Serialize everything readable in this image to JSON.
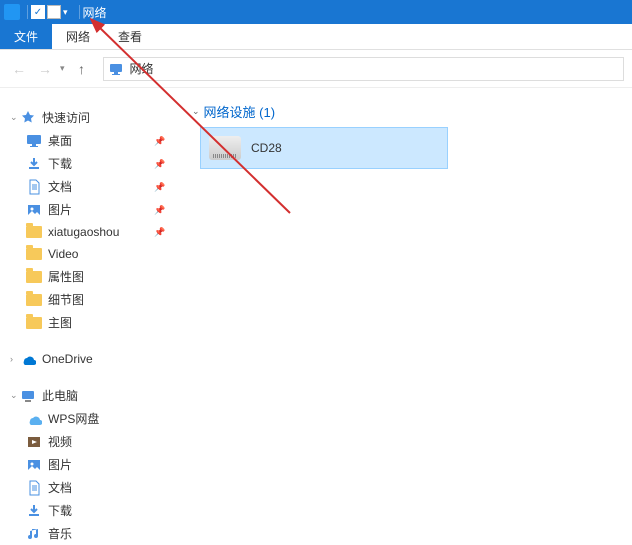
{
  "titlebar": {
    "title": "网络"
  },
  "ribbon": {
    "tabs": [
      {
        "label": "文件",
        "kind": "file"
      },
      {
        "label": "网络",
        "kind": "other"
      },
      {
        "label": "查看",
        "kind": "other"
      }
    ]
  },
  "navbar": {
    "address": "网络"
  },
  "sidebar": {
    "groups": [
      {
        "icon": "star",
        "label": "快速访问",
        "expanded": true,
        "items": [
          {
            "icon": "desktop",
            "label": "桌面",
            "pinned": true
          },
          {
            "icon": "download",
            "label": "下载",
            "pinned": true
          },
          {
            "icon": "document",
            "label": "文档",
            "pinned": true
          },
          {
            "icon": "picture",
            "label": "图片",
            "pinned": true
          },
          {
            "icon": "folder",
            "label": "xiatugaoshou",
            "pinned": true
          },
          {
            "icon": "folder",
            "label": "Video",
            "pinned": false
          },
          {
            "icon": "folder",
            "label": "属性图",
            "pinned": false
          },
          {
            "icon": "folder",
            "label": "细节图",
            "pinned": false
          },
          {
            "icon": "folder",
            "label": "主图",
            "pinned": false
          }
        ]
      },
      {
        "icon": "onedrive",
        "label": "OneDrive",
        "expanded": false,
        "items": []
      },
      {
        "icon": "thispc",
        "label": "此电脑",
        "expanded": true,
        "items": [
          {
            "icon": "wps",
            "label": "WPS网盘",
            "pinned": false
          },
          {
            "icon": "video",
            "label": "视频",
            "pinned": false
          },
          {
            "icon": "picture",
            "label": "图片",
            "pinned": false
          },
          {
            "icon": "document",
            "label": "文档",
            "pinned": false
          },
          {
            "icon": "download",
            "label": "下载",
            "pinned": false
          },
          {
            "icon": "music",
            "label": "音乐",
            "pinned": false
          }
        ]
      }
    ]
  },
  "content": {
    "section_label": "网络设施 (1)",
    "devices": [
      {
        "label": "CD28"
      }
    ]
  },
  "annotation": {
    "arrow_color": "#d32f2f"
  }
}
